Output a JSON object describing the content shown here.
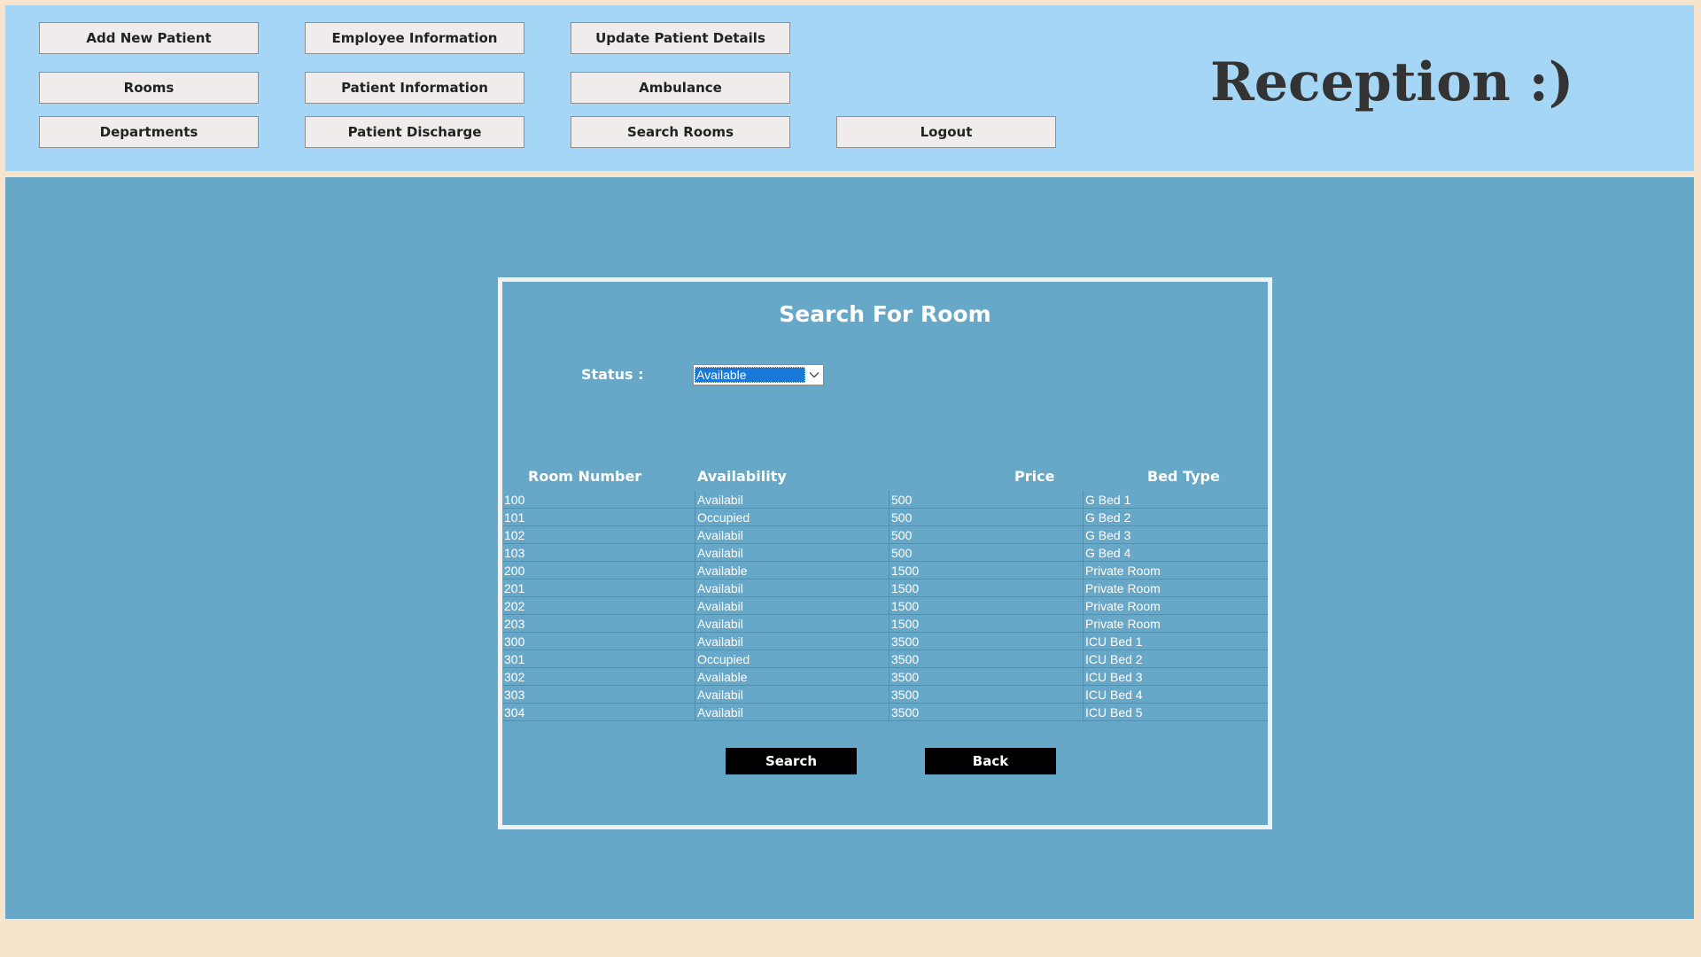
{
  "nav": {
    "add_new_patient": "Add New Patient",
    "employee_information": "Employee Information",
    "update_patient_details": "Update Patient Details",
    "rooms": "Rooms",
    "patient_information": "Patient Information",
    "ambulance": "Ambulance",
    "departments": "Departments",
    "patient_discharge": "Patient Discharge",
    "search_rooms": "Search Rooms",
    "logout": "Logout"
  },
  "header": {
    "title": "Reception :)"
  },
  "dialog": {
    "title": "Search For Room",
    "status_label": "Status :",
    "status_selected": "Available",
    "columns": {
      "room_number": "Room Number",
      "availability": "Availability",
      "price": "Price",
      "bed_type": "Bed Type"
    },
    "rows": [
      {
        "room": "100",
        "availability": "Availabil",
        "price": "500",
        "bed": "G Bed 1"
      },
      {
        "room": "101",
        "availability": "Occupied",
        "price": "500",
        "bed": "G Bed 2"
      },
      {
        "room": "102",
        "availability": "Availabil",
        "price": "500",
        "bed": "G Bed 3"
      },
      {
        "room": "103",
        "availability": "Availabil",
        "price": "500",
        "bed": "G Bed 4"
      },
      {
        "room": "200",
        "availability": "Available",
        "price": "1500",
        "bed": "Private Room"
      },
      {
        "room": "201",
        "availability": "Availabil",
        "price": "1500",
        "bed": "Private Room"
      },
      {
        "room": "202",
        "availability": "Availabil",
        "price": "1500",
        "bed": "Private Room"
      },
      {
        "room": "203",
        "availability": "Availabil",
        "price": "1500",
        "bed": "Private Room"
      },
      {
        "room": "300",
        "availability": "Availabil",
        "price": "3500",
        "bed": "ICU Bed 1"
      },
      {
        "room": "301",
        "availability": "Occupied",
        "price": "3500",
        "bed": "ICU Bed 2"
      },
      {
        "room": "302",
        "availability": "Available",
        "price": "3500",
        "bed": "ICU Bed 3"
      },
      {
        "room": "303",
        "availability": "Availabil",
        "price": "3500",
        "bed": "ICU Bed 4"
      },
      {
        "room": "304",
        "availability": "Availabil",
        "price": "3500",
        "bed": "ICU Bed 5"
      }
    ],
    "search_label": "Search",
    "back_label": "Back"
  },
  "colors": {
    "top_panel": "#a5d6f5",
    "main_panel": "#67a7c7",
    "page_background": "#f8e4cc",
    "selection": "#1a78d8",
    "action_button": "#000000"
  },
  "icons": {
    "dropdown": "chevron-down-icon"
  }
}
